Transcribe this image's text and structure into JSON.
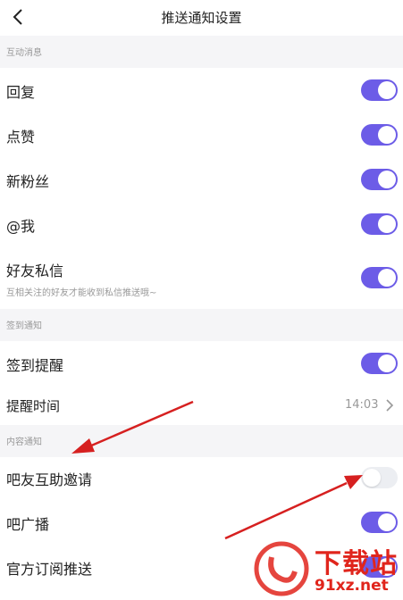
{
  "header": {
    "title": "推送通知设置",
    "back_icon": "chevron-left-icon"
  },
  "sections": {
    "interaction": "互动消息",
    "checkin": "签到通知",
    "content": "内容通知"
  },
  "rows": {
    "reply": {
      "label": "回复",
      "enabled": true
    },
    "like": {
      "label": "点赞",
      "enabled": true
    },
    "new_fans": {
      "label": "新粉丝",
      "enabled": true
    },
    "mention": {
      "label": "@我",
      "enabled": true
    },
    "private_msg": {
      "label": "好友私信",
      "hint": "互相关注的好友才能收到私信推送哦~",
      "enabled": true
    },
    "checkin_reminder": {
      "label": "签到提醒",
      "enabled": true
    },
    "reminder_time": {
      "label": "提醒时间",
      "value": "14:03"
    },
    "help_invite": {
      "label": "吧友互助邀请",
      "enabled": false
    },
    "broadcast": {
      "label": "吧广播",
      "enabled": true
    },
    "official_sub": {
      "label": "官方订阅推送",
      "enabled": true
    }
  },
  "watermark": {
    "main_text": "下载站",
    "sub_text": "91xz.net"
  },
  "colors": {
    "toggle_on": "#6c5ce7",
    "toggle_off": "#eceef2",
    "section_bg": "#f5f5f7",
    "annotation_arrow": "#d62020",
    "watermark": "#e0251c"
  }
}
